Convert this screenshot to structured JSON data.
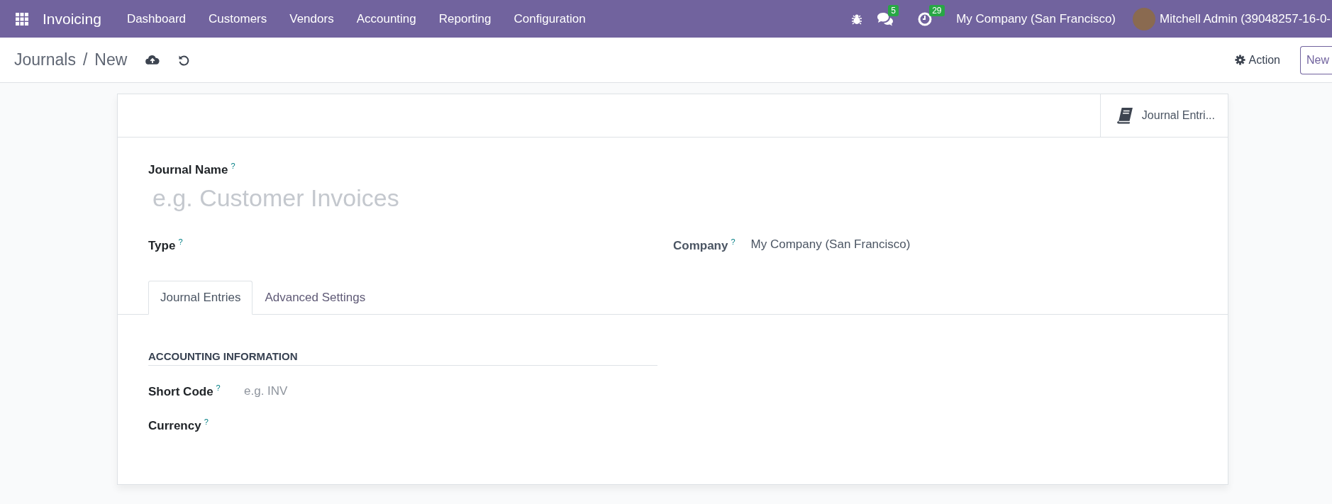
{
  "navbar": {
    "app_name": "Invoicing",
    "menu": [
      "Dashboard",
      "Customers",
      "Vendors",
      "Accounting",
      "Reporting",
      "Configuration"
    ],
    "messages_count": "5",
    "activities_count": "29",
    "company": "My Company (San Francisco)",
    "user": "Mitchell Admin (39048257-16-0-"
  },
  "control_panel": {
    "breadcrumb": "Journals",
    "separator": "/",
    "current": "New",
    "action": "Action",
    "new_button": "New"
  },
  "smart_button": {
    "label": "Journal Entri..."
  },
  "form": {
    "journal_name": {
      "label": "Journal Name",
      "help": "?",
      "placeholder": "e.g. Customer Invoices"
    },
    "type": {
      "label": "Type",
      "help": "?"
    },
    "company": {
      "label": "Company",
      "help": "?",
      "value": "My Company (San Francisco)"
    },
    "tabs": [
      {
        "label": "Journal Entries",
        "selected": true
      },
      {
        "label": "Advanced Settings",
        "selected": false
      }
    ],
    "section_title": "ACCOUNTING INFORMATION",
    "short_code": {
      "label": "Short Code",
      "help": "?",
      "placeholder": "e.g. INV"
    },
    "currency": {
      "label": "Currency",
      "help": "?"
    }
  }
}
